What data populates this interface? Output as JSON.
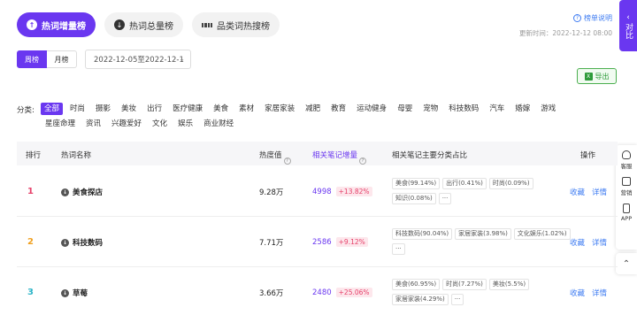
{
  "tabs": [
    {
      "label": "热词增量榜",
      "icon": "up-arrow-icon"
    },
    {
      "label": "热词总量榜",
      "icon": "down-arrow-icon"
    },
    {
      "label": "品类词热搜榜",
      "icon": "grid-icon"
    }
  ],
  "rules_link": "榜单说明",
  "update_time": "更新时间：2022-12-12 08:00",
  "side_panel": {
    "collapse_label": "对比",
    "tools": [
      "客服",
      "营销",
      "APP"
    ]
  },
  "period": {
    "week": "周榜",
    "month": "月榜"
  },
  "date_range": "2022-12-05至2022-12-1",
  "export_label": "导出",
  "categories": {
    "label": "分类:",
    "row1": [
      "全部",
      "时尚",
      "摄影",
      "美妆",
      "出行",
      "医疗健康",
      "美食",
      "素材",
      "家居家装",
      "减肥",
      "教育",
      "运动健身",
      "母婴",
      "宠物",
      "科技数码",
      "汽车",
      "婚嫁",
      "游戏"
    ],
    "row2": [
      "星座命理",
      "资讯",
      "兴趣爱好",
      "文化",
      "娱乐",
      "商业财经"
    ]
  },
  "table": {
    "headers": {
      "rank": "排行",
      "name": "热词名称",
      "heat": "热度值",
      "notes": "相关笔记增量",
      "dist": "相关笔记主要分类占比",
      "ops": "操作"
    },
    "rows": [
      {
        "rank": "1",
        "rank_color": "#e6416a",
        "name": "美食探店",
        "heat": "9.28万",
        "notes": "4998",
        "growth": "+13.82%",
        "chips": [
          "美食(99.14%)",
          "出行(0.41%)",
          "时尚(0.09%)",
          "知识(0.08%)",
          "···"
        ]
      },
      {
        "rank": "2",
        "rank_color": "#f0a020",
        "name": "科技数码",
        "heat": "7.71万",
        "notes": "2586",
        "growth": "+9.12%",
        "chips": [
          "科技数码(90.04%)",
          "家居家装(3.98%)",
          "文化娱乐(1.02%)",
          "···"
        ]
      },
      {
        "rank": "3",
        "rank_color": "#2eb5c8",
        "name": "草莓",
        "heat": "3.66万",
        "notes": "2480",
        "growth": "+25.06%",
        "chips": [
          "美食(60.95%)",
          "时尚(7.27%)",
          "美妆(5.5%)",
          "家居家装(4.29%)",
          "···"
        ]
      }
    ],
    "ops": {
      "fav": "收藏",
      "detail": "详情"
    }
  }
}
